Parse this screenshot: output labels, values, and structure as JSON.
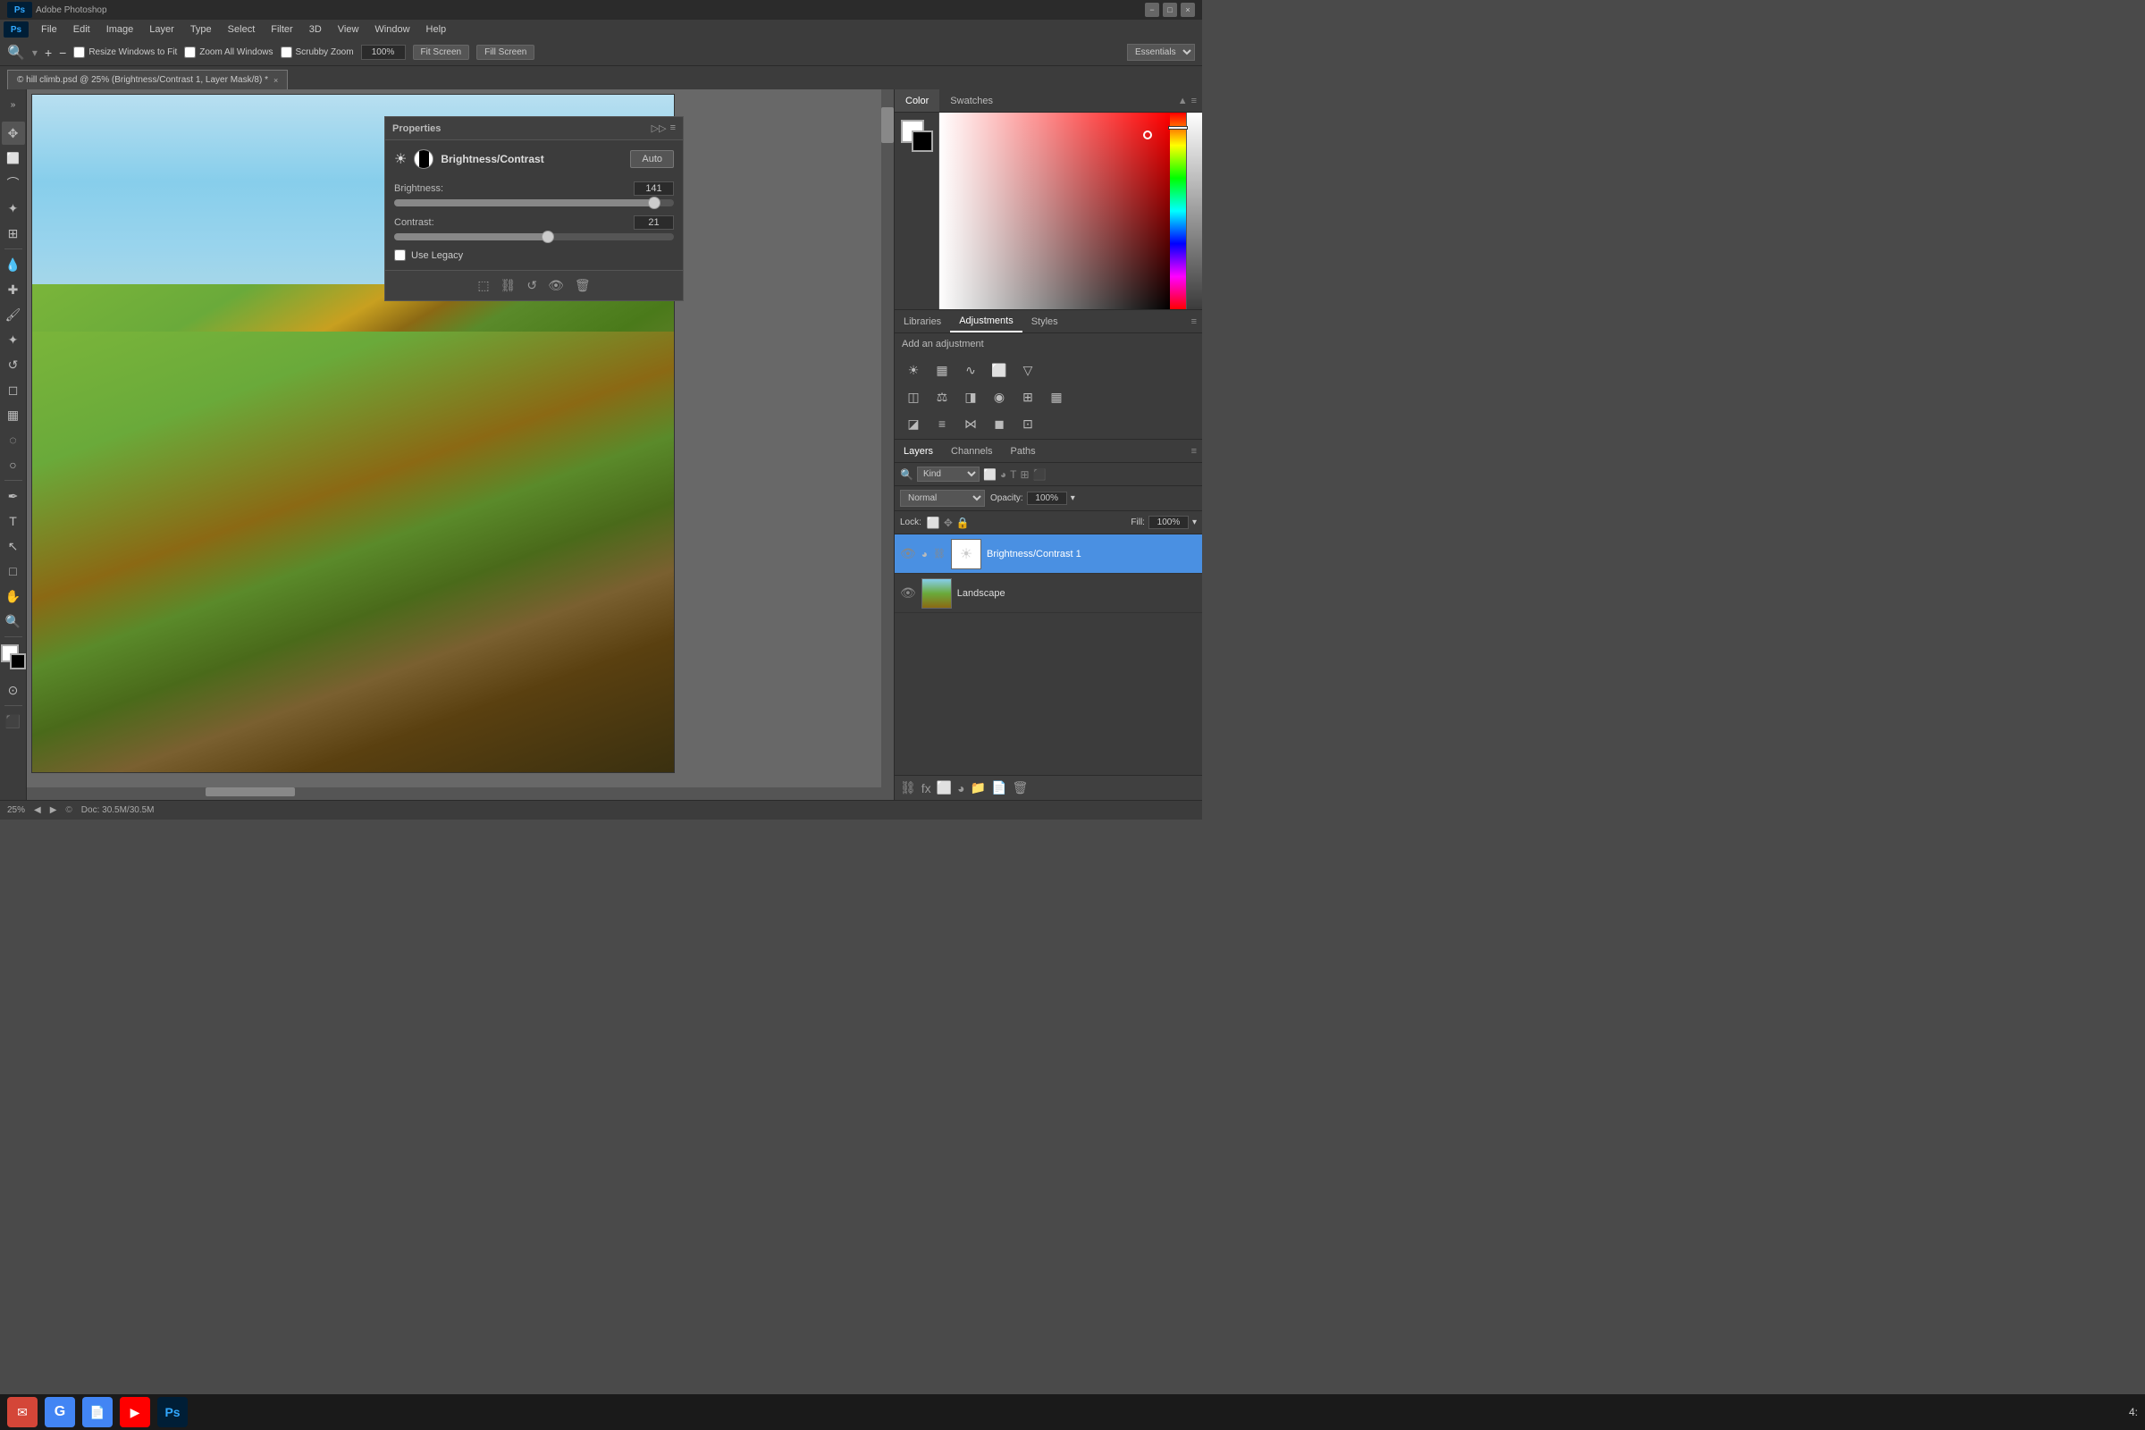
{
  "title_bar": {
    "app_name": "Adobe Photoshop",
    "ps_label": "Ps",
    "minimize_label": "−",
    "maximize_label": "□",
    "close_label": "×"
  },
  "menu_bar": {
    "items": [
      "PS",
      "File",
      "Edit",
      "Image",
      "Layer",
      "Type",
      "Select",
      "Filter",
      "3D",
      "View",
      "Window",
      "Help"
    ]
  },
  "options_bar": {
    "checkboxes": [
      "Resize Windows to Fit",
      "Zoom All Windows",
      "Scrubby Zoom"
    ],
    "zoom_percent": "100%",
    "fit_screen": "Fit Screen",
    "fill_screen": "Fill Screen",
    "workspace": "Essentials"
  },
  "document_tab": {
    "title": "© hill climb.psd @ 25% (Brightness/Contrast 1, Layer Mask/8) *",
    "close": "×"
  },
  "properties_panel": {
    "title": "Properties",
    "adjustment_name": "Brightness/Contrast",
    "auto_label": "Auto",
    "brightness_label": "Brightness:",
    "brightness_value": "141",
    "contrast_label": "Contrast:",
    "contrast_value": "21",
    "use_legacy_label": "Use Legacy",
    "brightness_percent": 93,
    "contrast_percent": 55
  },
  "color_panel": {
    "color_tab": "Color",
    "swatches_tab": "Swatches"
  },
  "adjustments_panel": {
    "libraries_tab": "Libraries",
    "adjustments_tab": "Adjustments",
    "styles_tab": "Styles",
    "add_adjustment_label": "Add an adjustment"
  },
  "layers_panel": {
    "layers_tab": "Layers",
    "channels_tab": "Channels",
    "paths_tab": "Paths",
    "search_placeholder": "Kind",
    "blend_mode": "Normal",
    "opacity_label": "Opacity:",
    "opacity_value": "100%",
    "lock_label": "Lock:",
    "fill_label": "Fill:",
    "fill_value": "100%",
    "layers": [
      {
        "name": "Brightness/Contrast 1",
        "type": "adjustment",
        "visible": true,
        "active": true
      },
      {
        "name": "Landscape",
        "type": "image",
        "visible": true,
        "active": false
      }
    ]
  },
  "status_bar": {
    "zoom": "25%",
    "doc_size": "Doc: 30.5M/30.5M"
  },
  "taskbar": {
    "icons": [
      "✉",
      "G",
      "📄",
      "▶",
      "Ps"
    ],
    "time": "4:"
  }
}
